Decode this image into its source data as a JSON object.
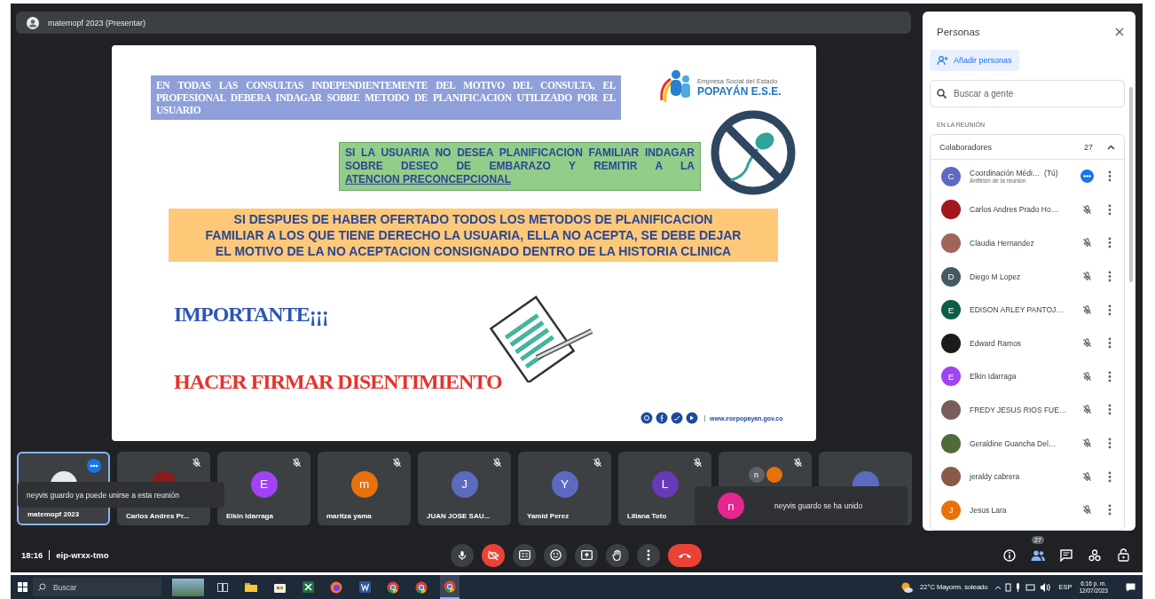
{
  "presenter_bar": {
    "title": "matemopf 2023 (Presentar)"
  },
  "slide": {
    "box_1": "EN TODAS LAS CONSULTAS INDEPENDIENTEMENTE DEL MOTIVO DEL CONSULTA, EL PROFESIONAL DEBERA INDAGAR SOBRE METODO DE PLANIFICACION UTILIZADO POR EL USUARIO",
    "logo": {
      "tagline": "Empresa Social del Estado",
      "name": "POPAYÁN E.S.E."
    },
    "box_2": {
      "text": "SI LA USUARIA NO DESEA PLANIFICACION FAMILIAR INDAGAR SOBRE DESEO DE EMBARAZO Y REMITIR A LA",
      "underlined": "ATENCION PRECONCEPCIONAL"
    },
    "box_3": "SI DESPUES DE HABER OFERTADO TODOS LOS METODOS DE PLANIFICACION FAMILIAR A LOS QUE TIENE DERECHO LA USUARIA, ELLA NO ACEPTA, SE DEBE DEJAR EL MOTIVO DE LA NO ACEPTACION CONSIGNADO DENTRO DE LA HISTORIA CLINICA",
    "heading": "IMPORTANTE¡¡¡",
    "warning": "HACER FIRMAR DISENTIMIENTO",
    "website": "www.esepopayan.gov.co"
  },
  "tiles": [
    {
      "name": "matemopf 2023",
      "avatar": {
        "kind": "photo",
        "color": "#e8eaed"
      },
      "muted": false,
      "speaking": true,
      "selected": true
    },
    {
      "name": "Carlos Andres Pr...",
      "avatar": {
        "kind": "photo",
        "color": "#8b1a1a"
      },
      "muted": true,
      "speaking": false,
      "selected": false
    },
    {
      "name": "Elkin Idarraga",
      "avatar": {
        "kind": "letter",
        "letter": "E",
        "color": "#a142f4"
      },
      "muted": true,
      "speaking": false,
      "selected": false
    },
    {
      "name": "maritza yama",
      "avatar": {
        "kind": "letter",
        "letter": "m",
        "color": "#e8710a"
      },
      "muted": true,
      "speaking": false,
      "selected": false
    },
    {
      "name": "JUAN JOSE SAU...",
      "avatar": {
        "kind": "letter",
        "letter": "J",
        "color": "#5c6bc0"
      },
      "muted": true,
      "speaking": false,
      "selected": false
    },
    {
      "name": "Yamid Perez",
      "avatar": {
        "kind": "letter",
        "letter": "Y",
        "color": "#5c6bc0"
      },
      "muted": true,
      "speaking": false,
      "selected": false
    },
    {
      "name": "Liliana Toto",
      "avatar": {
        "kind": "letter",
        "letter": "L",
        "color": "#673ab7"
      },
      "muted": true,
      "speaking": false,
      "selected": false
    },
    {
      "avatar": {
        "kind": "group",
        "members": [
          {
            "letter": "n",
            "color": "#5f6368"
          },
          {
            "color": "#e8710a"
          }
        ]
      },
      "muted": true,
      "speaking": false,
      "selected": false
    },
    {
      "avatar": {
        "kind": "letter",
        "color": "#5c6bc0"
      },
      "muted": false,
      "speaking": false,
      "selected": false
    }
  ],
  "toasts": [
    {
      "text": "neyvis guardo ya puede unirse a esta reunión"
    },
    {
      "text": "neyvis guardo se ha unido",
      "avatar": {
        "letter": "n",
        "color": "#e52592"
      }
    }
  ],
  "meeting": {
    "time": "18:16",
    "code": "eip-wrxx-tmo"
  },
  "controls": [
    {
      "kind": "mic",
      "off": false
    },
    {
      "kind": "camera",
      "off": true
    },
    {
      "kind": "captions"
    },
    {
      "kind": "emoji"
    },
    {
      "kind": "present"
    },
    {
      "kind": "hand"
    },
    {
      "kind": "more"
    },
    {
      "kind": "hangup"
    }
  ],
  "side_controls": [
    {
      "kind": "info"
    },
    {
      "kind": "people",
      "badge": "27"
    },
    {
      "kind": "chat"
    },
    {
      "kind": "activities"
    },
    {
      "kind": "lock"
    }
  ],
  "people_panel": {
    "title": "Personas",
    "add_button": "Añadir personas",
    "search_placeholder": "Buscar a gente",
    "section": "EN LA REUNIÓN",
    "group": {
      "label": "Colaboradores",
      "count": "27",
      "expanded": true
    },
    "people": [
      {
        "name": "Coordinación Médi…",
        "suffix": "(Tú)",
        "role": "Anfitrión de la reunión",
        "avatar": {
          "kind": "letter",
          "letter": "C",
          "color": "#5c6bc0"
        },
        "muted": false,
        "speaking": true
      },
      {
        "name": "Carlos Andres Prado Ho…",
        "avatar": {
          "kind": "photo",
          "color": "#a3161b"
        },
        "muted": true,
        "speaking": false
      },
      {
        "name": "Claudia Hernandez",
        "avatar": {
          "kind": "photo",
          "color": "#a0655a"
        },
        "muted": true,
        "speaking": false
      },
      {
        "name": "Diego M Lopez",
        "avatar": {
          "kind": "letter",
          "letter": "D",
          "color": "#455a64"
        },
        "muted": true,
        "speaking": false
      },
      {
        "name": "EDISON ARLEY PANTOJ…",
        "avatar": {
          "kind": "letter",
          "letter": "E",
          "color": "#0b5d48"
        },
        "muted": true,
        "speaking": false
      },
      {
        "name": "Edward Ramos",
        "avatar": {
          "kind": "photo",
          "color": "#1b1b1b"
        },
        "muted": true,
        "speaking": false
      },
      {
        "name": "Elkin Idarraga",
        "avatar": {
          "kind": "letter",
          "letter": "E",
          "color": "#a142f4"
        },
        "muted": true,
        "speaking": false
      },
      {
        "name": "FREDY JESUS RIOS FUE…",
        "avatar": {
          "kind": "photo",
          "color": "#7a5c5c"
        },
        "muted": true,
        "speaking": false
      },
      {
        "name": "Geraldine Guancha Del…",
        "avatar": {
          "kind": "photo",
          "color": "#4f6b3a"
        },
        "muted": true,
        "speaking": false
      },
      {
        "name": "jeraldy cabrera",
        "avatar": {
          "kind": "photo",
          "color": "#8a5a48"
        },
        "muted": true,
        "speaking": false
      },
      {
        "name": "Jesus Lara",
        "avatar": {
          "kind": "letter",
          "letter": "J",
          "color": "#e8710a"
        },
        "muted": true,
        "speaking": false
      }
    ]
  },
  "taskbar": {
    "search_placeholder": "Buscar",
    "apps": [
      {
        "kind": "task-view",
        "selected": false
      },
      {
        "kind": "folder",
        "selected": false
      },
      {
        "kind": "store",
        "selected": false
      },
      {
        "kind": "excel",
        "selected": false
      },
      {
        "kind": "firefox",
        "selected": false
      },
      {
        "kind": "word",
        "selected": false
      },
      {
        "kind": "chrome",
        "selected": false
      },
      {
        "kind": "chrome",
        "selected": false
      },
      {
        "kind": "chrome",
        "selected": true
      }
    ],
    "weather": "22°C Mayorm. soleado",
    "language": "ESP",
    "time": "6:16 p. m.",
    "date": "12/07/2023"
  }
}
